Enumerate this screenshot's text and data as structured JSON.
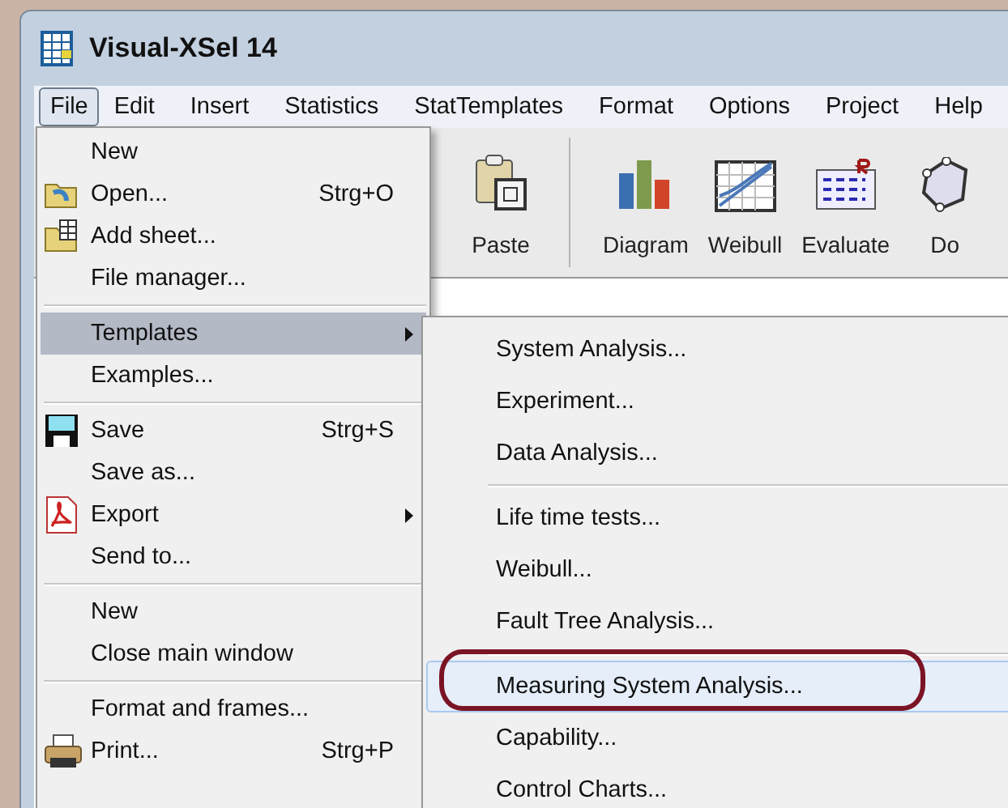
{
  "window": {
    "title": "Visual-XSel 14"
  },
  "menu_bar": [
    {
      "label": "File",
      "selected": true
    },
    {
      "label": "Edit",
      "selected": false
    },
    {
      "label": "Insert",
      "selected": false
    },
    {
      "label": "Statistics",
      "selected": false
    },
    {
      "label": "StatTemplates",
      "selected": false
    },
    {
      "label": "Format",
      "selected": false
    },
    {
      "label": "Options",
      "selected": false
    },
    {
      "label": "Project",
      "selected": false
    },
    {
      "label": "Help",
      "selected": false
    }
  ],
  "toolbar": [
    {
      "label": "Paste",
      "kind": "paste"
    },
    {
      "label": "Diagram",
      "kind": "diagram"
    },
    {
      "label": "Weibull",
      "kind": "weibull"
    },
    {
      "label": "Evaluate",
      "kind": "evaluate"
    },
    {
      "label": "Do",
      "kind": "doe"
    }
  ],
  "file_menu": [
    [
      {
        "label": "New",
        "selected": false
      },
      {
        "label": "Open...",
        "shortcut": "Strg+O",
        "kind": "open",
        "selected": false
      },
      {
        "label": "Add sheet...",
        "kind": "add-sheet",
        "selected": false
      },
      {
        "label": "File manager...",
        "selected": false
      }
    ],
    [
      {
        "label": "Templates",
        "submenu": true,
        "selected": true
      },
      {
        "label": "Examples...",
        "selected": false
      }
    ],
    [
      {
        "label": "Save",
        "shortcut": "Strg+S",
        "kind": "save",
        "selected": false
      },
      {
        "label": "Save as...",
        "selected": false
      },
      {
        "label": "Export",
        "kind": "pdf",
        "submenu": true,
        "selected": false
      },
      {
        "label": "Send to...",
        "selected": false
      }
    ],
    [
      {
        "label": "New",
        "selected": false
      },
      {
        "label": "Close main window",
        "selected": false
      }
    ],
    [
      {
        "label": "Format and frames...",
        "selected": false
      },
      {
        "label": "Print...",
        "shortcut": "Strg+P",
        "kind": "print",
        "selected": false
      }
    ]
  ],
  "templates_menu": [
    [
      {
        "label": "System Analysis...",
        "selected": false
      },
      {
        "label": "Experiment...",
        "selected": false
      },
      {
        "label": "Data Analysis...",
        "selected": false
      }
    ],
    [
      {
        "label": "Life time tests...",
        "selected": false
      },
      {
        "label": "Weibull...",
        "selected": false
      },
      {
        "label": "Fault Tree Analysis...",
        "selected": false
      }
    ],
    [
      {
        "label": "Measuring System Analysis...",
        "selected": true,
        "circled": true
      },
      {
        "label": "Capability...",
        "selected": false
      },
      {
        "label": "Control Charts...",
        "selected": false
      }
    ]
  ]
}
